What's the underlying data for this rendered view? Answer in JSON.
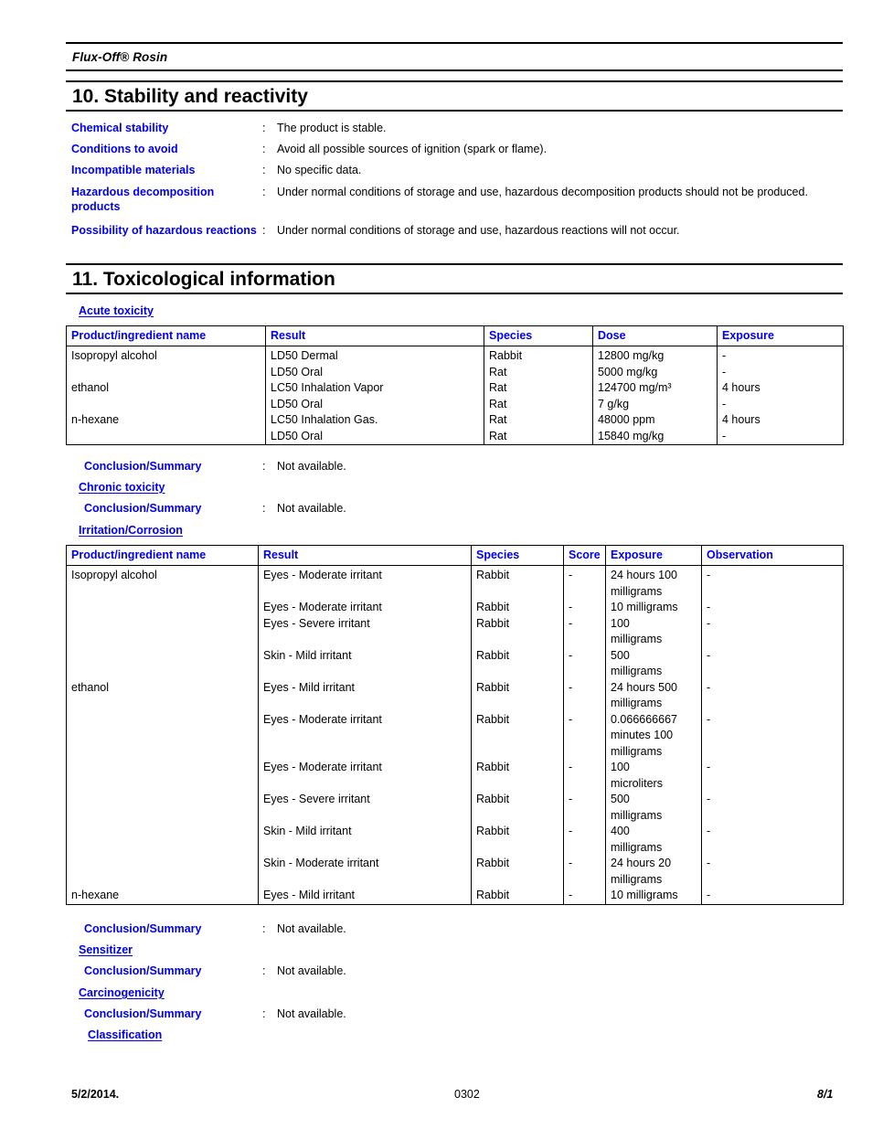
{
  "document": {
    "running_header_title": "Flux-Off® Rosin"
  },
  "section10": {
    "heading": "10. Stability and reactivity",
    "rows": [
      {
        "label": "Chemical stability",
        "colon": ":",
        "value": "The product is stable."
      },
      {
        "label": "Conditions to avoid",
        "colon": ":",
        "value": "Avoid all possible sources of ignition (spark or flame)."
      },
      {
        "label": "Incompatible materials",
        "colon": ":",
        "value": "No specific data."
      },
      {
        "label": "Hazardous decomposition products",
        "colon": ":",
        "value": "Under normal conditions of storage and use, hazardous decomposition products should not be produced."
      },
      {
        "label": "Possibility of hazardous reactions",
        "colon": ":",
        "value": "Under normal conditions of storage and use, hazardous reactions will not occur."
      }
    ]
  },
  "section11": {
    "heading": "11. Toxicological information",
    "acute_toxicity": {
      "subheading": "Acute toxicity",
      "headers": [
        "Product/ingredient name",
        "Result",
        "Species",
        "Dose",
        "Exposure"
      ],
      "rows": [
        {
          "name": "Isopropyl alcohol",
          "result": "LD50 Dermal",
          "species": "Rabbit",
          "dose": "12800 mg/kg",
          "exposure": "-"
        },
        {
          "name": "",
          "result": "LD50 Oral",
          "species": "Rat",
          "dose": "5000 mg/kg",
          "exposure": "-"
        },
        {
          "name": "ethanol",
          "result": "LC50 Inhalation Vapor",
          "species": "Rat",
          "dose": "124700 mg/m³",
          "exposure": "4 hours"
        },
        {
          "name": "",
          "result": "LD50 Oral",
          "species": "Rat",
          "dose": "7 g/kg",
          "exposure": "-"
        },
        {
          "name": "n-hexane",
          "result": "LC50 Inhalation Gas.",
          "species": "Rat",
          "dose": "48000 ppm",
          "exposure": "4 hours"
        },
        {
          "name": "",
          "result": "LD50 Oral",
          "species": "Rat",
          "dose": "15840 mg/kg",
          "exposure": "-"
        }
      ],
      "conclusion_label": "Conclusion/Summary",
      "conclusion_colon": ":",
      "conclusion_value": "Not available."
    },
    "chronic_toxicity": {
      "subheading": "Chronic toxicity",
      "conclusion_label": "Conclusion/Summary",
      "conclusion_colon": ":",
      "conclusion_value": "Not available."
    },
    "irritation_corrosion": {
      "subheading": "Irritation/Corrosion",
      "headers": [
        "Product/ingredient name",
        "Result",
        "Species",
        "Score",
        "Exposure",
        "Observation"
      ],
      "rows": [
        {
          "name": "Isopropyl alcohol",
          "result": "Eyes - Moderate irritant",
          "species": "Rabbit",
          "score": "-",
          "exposure": "24 hours 100\nmilligrams",
          "observation": "-"
        },
        {
          "name": "",
          "result": "Eyes - Moderate irritant",
          "species": "Rabbit",
          "score": "-",
          "exposure": "10 milligrams",
          "observation": "-"
        },
        {
          "name": "",
          "result": "Eyes - Severe irritant",
          "species": "Rabbit",
          "score": "-",
          "exposure": "100\nmilligrams",
          "observation": "-"
        },
        {
          "name": "",
          "result": "Skin - Mild irritant",
          "species": "Rabbit",
          "score": "-",
          "exposure": "500\nmilligrams",
          "observation": "-"
        },
        {
          "name": "ethanol",
          "result": "Eyes - Mild irritant",
          "species": "Rabbit",
          "score": "-",
          "exposure": "24 hours 500\nmilligrams",
          "observation": "-"
        },
        {
          "name": "",
          "result": "Eyes - Moderate irritant",
          "species": "Rabbit",
          "score": "-",
          "exposure": "0.066666667\nminutes 100\nmilligrams",
          "observation": "-"
        },
        {
          "name": "",
          "result": "Eyes - Moderate irritant",
          "species": "Rabbit",
          "score": "-",
          "exposure": "100\nmicroliters",
          "observation": "-"
        },
        {
          "name": "",
          "result": "Eyes - Severe irritant",
          "species": "Rabbit",
          "score": "-",
          "exposure": "500\nmilligrams",
          "observation": "-"
        },
        {
          "name": "",
          "result": "Skin - Mild irritant",
          "species": "Rabbit",
          "score": "-",
          "exposure": "400\nmilligrams",
          "observation": "-"
        },
        {
          "name": "",
          "result": "Skin - Moderate irritant",
          "species": "Rabbit",
          "score": "-",
          "exposure": "24 hours 20\nmilligrams",
          "observation": "-"
        },
        {
          "name": "n-hexane",
          "result": "Eyes - Mild irritant",
          "species": "Rabbit",
          "score": "-",
          "exposure": "10 milligrams",
          "observation": "-"
        }
      ],
      "conclusion_label": "Conclusion/Summary",
      "conclusion_colon": ":",
      "conclusion_value": "Not available."
    },
    "sensitizer": {
      "subheading": "Sensitizer",
      "conclusion_label": "Conclusion/Summary",
      "conclusion_colon": ":",
      "conclusion_value": "Not available."
    },
    "carcinogenicity": {
      "subheading": "Carcinogenicity",
      "conclusion_label": "Conclusion/Summary",
      "conclusion_colon": ":",
      "conclusion_value": "Not available.",
      "classification_subheading": "Classification"
    }
  },
  "footer": {
    "date": "5/2/2014.",
    "code": "0302",
    "page": "8/1"
  },
  "colors": {
    "link_blue": "#0000EE",
    "text_black": "#000000",
    "page_background": "#ffffff"
  }
}
